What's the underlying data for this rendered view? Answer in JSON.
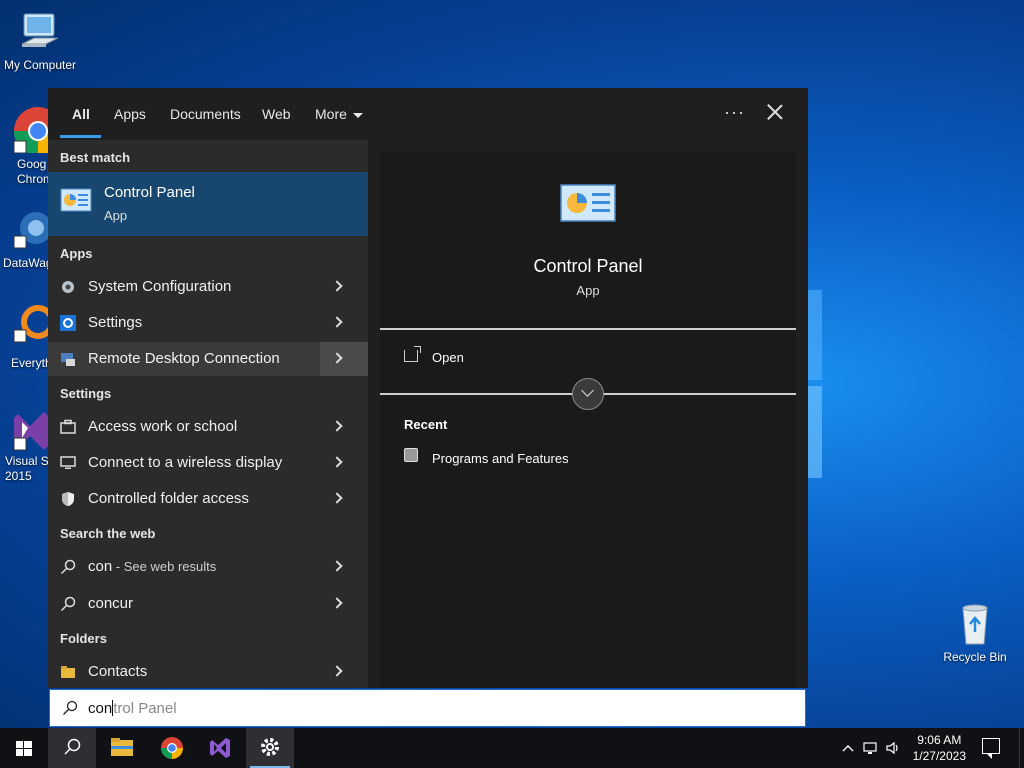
{
  "desktop": {
    "icons": [
      {
        "label": "My Computer"
      },
      {
        "label": "Goog Chrom"
      },
      {
        "label": "DataWag"
      },
      {
        "label": "Everyth"
      },
      {
        "label": "Visual St 2015"
      },
      {
        "label": "Recycle Bin"
      }
    ]
  },
  "search": {
    "tabs": {
      "all": "All",
      "apps": "Apps",
      "documents": "Documents",
      "web": "Web",
      "more": "More"
    },
    "options_glyph": "···",
    "sections": {
      "best_match": "Best match",
      "apps": "Apps",
      "settings": "Settings",
      "search_web": "Search the web",
      "folders": "Folders"
    },
    "best_match": {
      "title": "Control Panel",
      "type": "App"
    },
    "apps": [
      {
        "label": "System Configuration"
      },
      {
        "label": "Settings"
      },
      {
        "label": "Remote Desktop Connection"
      }
    ],
    "settings": [
      {
        "label": "Access work or school"
      },
      {
        "label": "Connect to a wireless display"
      },
      {
        "label": "Controlled folder access"
      }
    ],
    "web": [
      {
        "label": "con",
        "sub": " - See web results"
      },
      {
        "label": "concur"
      }
    ],
    "folders": [
      {
        "label": "Contacts"
      }
    ],
    "preview": {
      "title": "Control Panel",
      "type": "App",
      "open_label": "Open",
      "recent_header": "Recent",
      "recent_items": [
        "Programs and Features"
      ]
    },
    "query_typed": "con",
    "query_suggestion": "trol Panel"
  },
  "taskbar": {
    "time": "9:06 AM",
    "date": "1/27/2023"
  },
  "colors": {
    "accent": "#3a9be8",
    "best_match_bg": "#17476e",
    "flyout_bg": "#1f1f1f"
  }
}
